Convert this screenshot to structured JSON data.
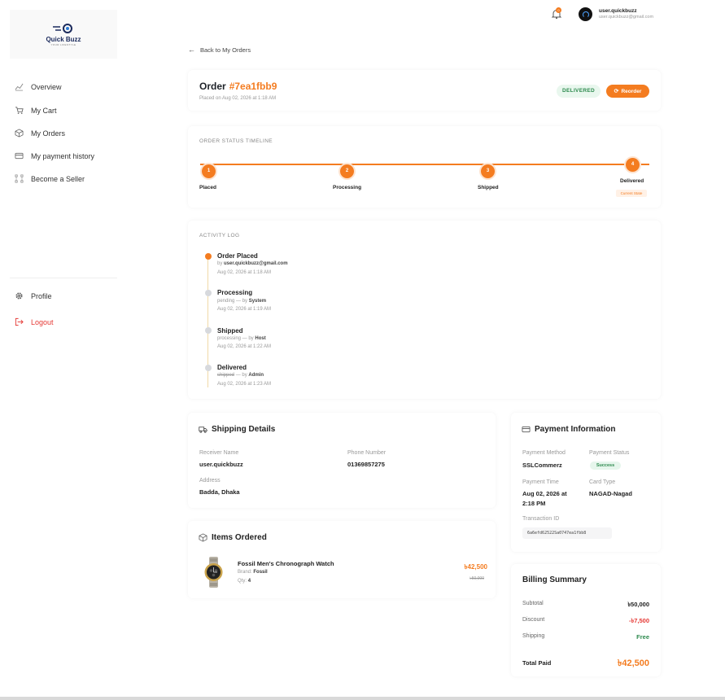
{
  "brand": {
    "name": "Quick Buzz",
    "tagline": "YOUR LIFESTYLE"
  },
  "sidebar": {
    "items": [
      {
        "label": "Overview",
        "icon": "chart-line-icon"
      },
      {
        "label": "My Cart",
        "icon": "cart-icon"
      },
      {
        "label": "My Orders",
        "icon": "box-icon"
      },
      {
        "label": "My payment history",
        "icon": "card-icon"
      },
      {
        "label": "Become a Seller",
        "icon": "network-icon"
      }
    ],
    "profile": "Profile",
    "logout": "Logout"
  },
  "header": {
    "notification_count": "0",
    "user_name": "user.quickbuzz",
    "user_email": "user.quickbuzz@gmail.com"
  },
  "order": {
    "back_label": "Back to My Orders",
    "title_prefix": "Order",
    "id": "#7ea1fbb9",
    "placed_on": "Placed on Aug 02, 2026 at 1:18 AM",
    "status_badge": "DELIVERED",
    "reorder_label": "Reorder"
  },
  "timeline": {
    "heading": "ORDER STATUS TIMELINE",
    "steps": [
      {
        "num": "1",
        "label": "Placed"
      },
      {
        "num": "2",
        "label": "Processing"
      },
      {
        "num": "3",
        "label": "Shipped"
      },
      {
        "num": "4",
        "label": "Delivered"
      }
    ],
    "current_label": "Current State"
  },
  "activity": {
    "heading": "ACTIVITY LOG",
    "entries": [
      {
        "title": "Order Placed",
        "prefix": "by ",
        "actor": "user.quickbuzz@gmail.com",
        "time": "Aug 02, 2026 at 1:18 AM"
      },
      {
        "title": "Processing",
        "prefix": "pending — by ",
        "actor": "System",
        "time": "Aug 02, 2026 at 1:19 AM"
      },
      {
        "title": "Shipped",
        "prefix": "processing — by ",
        "actor": "Host",
        "time": "Aug 02, 2026 at 1:22 AM"
      },
      {
        "title": "Delivered",
        "strike": "shipped",
        "prefix": " — by ",
        "actor": "Admin",
        "time": "Aug 02, 2026 at 1:23 AM"
      }
    ]
  },
  "shipping": {
    "heading": "Shipping Details",
    "receiver_label": "Receiver Name",
    "receiver": "user.quickbuzz",
    "phone_label": "Phone Number",
    "phone": "01369857275",
    "address_label": "Address",
    "address": "Badda, Dhaka"
  },
  "items": {
    "heading": "Items Ordered",
    "list": [
      {
        "name": "Fossil Men's Chronograph Watch",
        "brand_label": "Brand:",
        "brand": "Fossil",
        "qty_label": "Qty:",
        "qty": "4",
        "price": "৳42,500",
        "old_price": "৳50,000"
      }
    ]
  },
  "payment": {
    "heading": "Payment Information",
    "method_label": "Payment Method",
    "method": "SSLCommerz",
    "status_label": "Payment Status",
    "status": "Success",
    "time_label": "Payment Time",
    "time_line1": "Aug 02, 2026 at",
    "time_line2": "2:18 PM",
    "card_label": "Card Type",
    "card": "NAGAD-Nagad",
    "txn_label": "Transaction ID",
    "txn": "6a6efd62522Sa0747ea1fbb8"
  },
  "billing": {
    "heading": "Billing Summary",
    "subtotal_label": "Subtotal",
    "subtotal": "৳50,000",
    "discount_label": "Discount",
    "discount": "-৳7,500",
    "shipping_label": "Shipping",
    "shipping": "Free",
    "total_label": "Total Paid",
    "total": "৳42,500"
  },
  "colors": {
    "accent": "#f47c20",
    "success": "#2d8a4e",
    "danger": "#e53935"
  }
}
